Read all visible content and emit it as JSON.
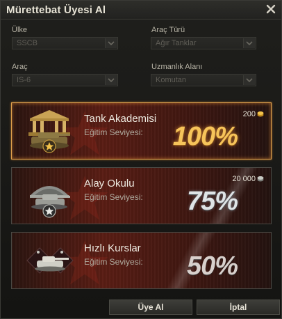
{
  "window": {
    "title": "Mürettebat Üyesi Al"
  },
  "filters": {
    "country": {
      "label": "Ülke",
      "value": "SSCB"
    },
    "vehicle_type": {
      "label": "Araç Türü",
      "value": "Ağır Tanklar"
    },
    "vehicle": {
      "label": "Araç",
      "value": "IS-6"
    },
    "specialization": {
      "label": "Uzmanlık Alanı",
      "value": "Komutan"
    }
  },
  "options": [
    {
      "name": "Tank Akademisi",
      "level_label": "Eğitim Seviyesi:",
      "percent": "100%",
      "price": "200",
      "currency": "gold",
      "selected": true
    },
    {
      "name": "Alay Okulu",
      "level_label": "Eğitim Seviyesi:",
      "percent": "75%",
      "price": "20 000",
      "currency": "credits",
      "selected": false
    },
    {
      "name": "Hızlı Kurslar",
      "level_label": "Eğitim Seviyesi:",
      "percent": "50%",
      "price": "",
      "currency": "",
      "selected": false
    }
  ],
  "buttons": {
    "confirm": "Üye Al",
    "cancel": "İptal"
  },
  "colors": {
    "selected_border": "#e0a14c",
    "gold_text": "#f6c45a"
  }
}
